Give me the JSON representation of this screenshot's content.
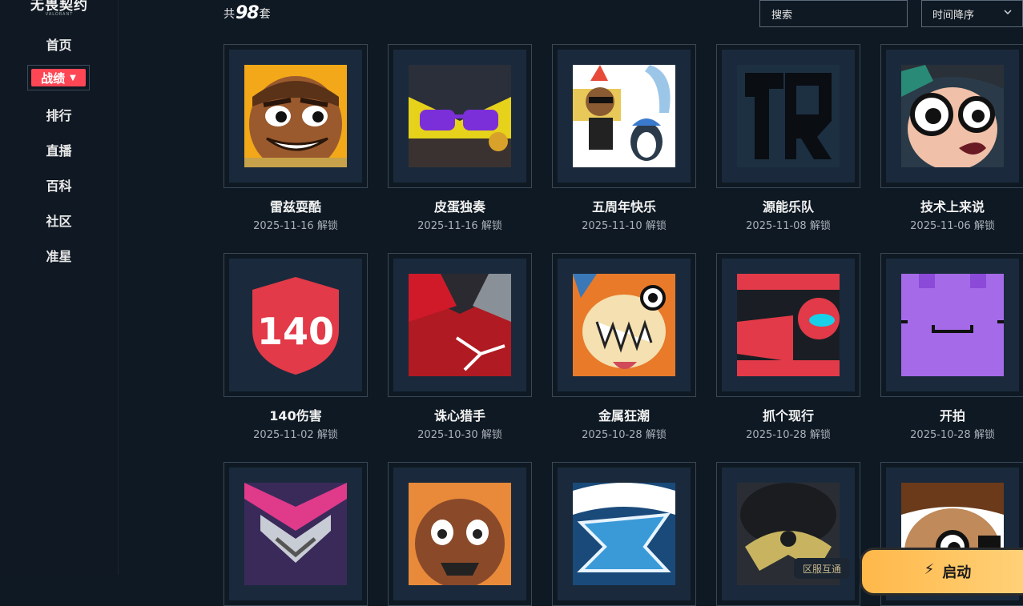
{
  "logo": {
    "main": "无畏契约",
    "sub": "VALORANT"
  },
  "nav": {
    "items": [
      "首页",
      "战绩",
      "排行",
      "直播",
      "百科",
      "社区",
      "准星"
    ],
    "active_index": 1
  },
  "header": {
    "count_prefix": "共",
    "count": "98",
    "count_suffix": "套",
    "search_placeholder": "搜索",
    "sort_label": "时间降序"
  },
  "cards": [
    {
      "title": "雷兹耍酷",
      "date": "2025-11-16 解锁",
      "icon": "raze-face-icon"
    },
    {
      "title": "皮蛋独奏",
      "date": "2025-11-16 解锁",
      "icon": "purple-glasses-icon"
    },
    {
      "title": "五周年快乐",
      "date": "2025-11-10 解锁",
      "icon": "bear-penguin-icon"
    },
    {
      "title": "源能乐队",
      "date": "2025-11-08 解锁",
      "icon": "band-logo-icon"
    },
    {
      "title": "技术上来说",
      "date": "2025-11-06 解锁",
      "icon": "glasses-face-icon"
    },
    {
      "title": "140伤害",
      "date": "2025-11-02 解锁",
      "icon": "damage-140-icon",
      "art_text": "140"
    },
    {
      "title": "诛心猎手",
      "date": "2025-10-30 解锁",
      "icon": "red-crystal-icon"
    },
    {
      "title": "金属狂潮",
      "date": "2025-10-28 解锁",
      "icon": "teeth-creature-icon"
    },
    {
      "title": "抓个现行",
      "date": "2025-10-28 解锁",
      "icon": "red-robot-icon"
    },
    {
      "title": "开拍",
      "date": "2025-10-28 解锁",
      "icon": "purple-block-icon"
    },
    {
      "title": "",
      "date": "",
      "icon": "silver-wings-icon"
    },
    {
      "title": "",
      "date": "",
      "icon": "brown-creature-icon"
    },
    {
      "title": "",
      "date": "",
      "icon": "blue-logo-icon"
    },
    {
      "title": "",
      "date": "",
      "icon": "gold-crest-icon"
    },
    {
      "title": "",
      "date": "",
      "icon": "pirate-face-icon"
    }
  ],
  "footer": {
    "region_badge": "区服互通",
    "launch_label": "启动"
  },
  "colors": {
    "accent": "#ff4655",
    "background": "#0f1923",
    "launch": "#ffc25e"
  }
}
